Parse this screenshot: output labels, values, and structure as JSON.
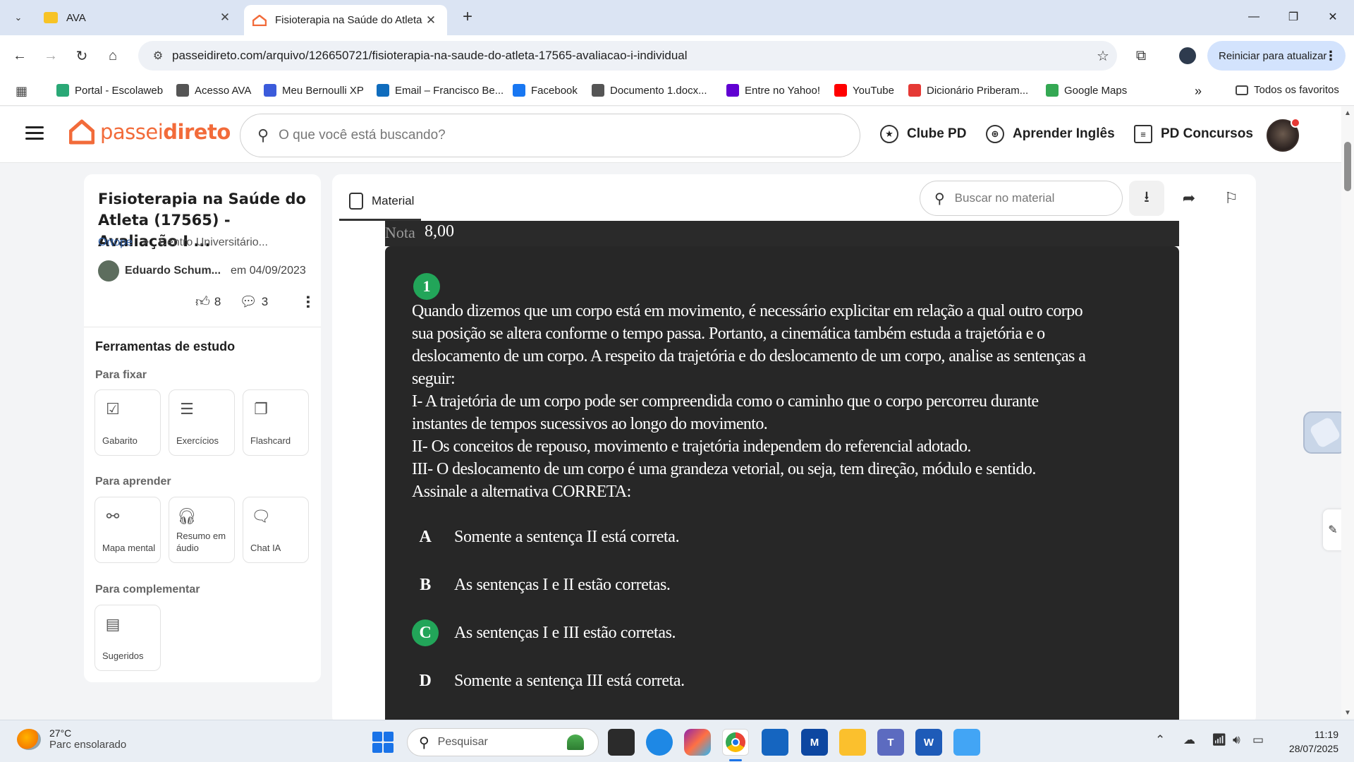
{
  "browser": {
    "tabs": [
      {
        "title": "AVA",
        "active": false
      },
      {
        "title": "Fisioterapia na Saúde do Atleta",
        "active": true
      }
    ],
    "url": "passeidireto.com/arquivo/126650721/fisioterapia-na-saude-do-atleta-17565-avaliacao-i-individual",
    "update_button": "Reiniciar para atualizar",
    "bookmarks": [
      {
        "label": "Portal - Escolaweb",
        "icon": "escolaweb-icon",
        "color": "#2aa876"
      },
      {
        "label": "Acesso AVA",
        "icon": "globe-icon",
        "color": "#555555"
      },
      {
        "label": "Meu Bernoulli XP",
        "icon": "bernoulli-icon",
        "color": "#3b5bdb"
      },
      {
        "label": "Email – Francisco Be...",
        "icon": "outlook-icon",
        "color": "#0f6cbd"
      },
      {
        "label": "Facebook",
        "icon": "facebook-icon",
        "color": "#1877f2"
      },
      {
        "label": "Documento 1.docx...",
        "icon": "globe-icon",
        "color": "#555555"
      },
      {
        "label": "Entre no Yahoo!",
        "icon": "yahoo-icon",
        "color": "#6001d2"
      },
      {
        "label": "YouTube",
        "icon": "youtube-icon",
        "color": "#ff0000"
      },
      {
        "label": "Dicionário Priberam...",
        "icon": "priberam-icon",
        "color": "#e53935"
      },
      {
        "label": "Google Maps",
        "icon": "maps-pin-icon",
        "color": "#34a853"
      }
    ],
    "all_bookmarks": "Todos os favoritos"
  },
  "site": {
    "logo_part1": "passei",
    "logo_part2": "direto",
    "brand_color": "#f26b3a",
    "search_placeholder": "O que você está buscando?",
    "nav": [
      "Clube PD",
      "Aprender Inglês",
      "PD Concursos"
    ]
  },
  "sidebar": {
    "title": "Fisioterapia na Saúde do Atleta (17565) - Avaliação I ...",
    "crumb1": "Ortope",
    "crumb_sep": ">",
    "crumb2": "Centro Universitário...",
    "author": "Eduardo Schum...",
    "date": "em 04/09/2023",
    "likes": "8",
    "comments": "3",
    "tools_title": "Ferramentas de estudo",
    "groups": {
      "fixar": "Para fixar",
      "aprender": "Para aprender",
      "complementar": "Para complementar"
    },
    "tiles": {
      "gabarito": "Gabarito",
      "exercicios": "Exercícios",
      "flashcard": "Flashcard",
      "mapa": "Mapa mental",
      "resumo": "Resumo em áudio",
      "chat": "Chat IA",
      "sugeridos": "Sugeridos"
    }
  },
  "viewer": {
    "tab": "Material",
    "search_placeholder": "Buscar no material",
    "nota_label": "Nota",
    "nota_value": "8,00",
    "question_number": "1",
    "question_lines": [
      "Quando dizemos que um corpo está em movimento, é necessário explicitar em relação a qual outro corpo",
      "sua posição se altera conforme o tempo passa. Portanto, a cinemática também estuda a trajetória e o",
      "deslocamento de um corpo. A respeito da trajetória e do deslocamento de um corpo, analise as sentenças a",
      "seguir:",
      "I- A trajetória de um corpo pode ser compreendida como o caminho que o corpo percorreu durante",
      "instantes de tempos sucessivos ao longo do movimento.",
      "II- Os conceitos de repouso, movimento e trajetória independem do referencial adotado.",
      "III- O deslocamento de um corpo é uma grandeza vetorial, ou seja, tem direção, módulo e sentido.",
      "Assinale a alternativa CORRETA:"
    ],
    "options": [
      {
        "letter": "A",
        "text": "Somente a sentença II está correta.",
        "correct": false
      },
      {
        "letter": "B",
        "text": "As sentenças I e II estão corretas.",
        "correct": false
      },
      {
        "letter": "C",
        "text": "As sentenças I e III estão corretas.",
        "correct": true
      },
      {
        "letter": "D",
        "text": "Somente a sentença III está correta.",
        "correct": false
      }
    ],
    "correct_color": "#22a559"
  },
  "taskbar": {
    "temperature": "27°C",
    "condition": "Parc ensolarado",
    "search": "Pesquisar",
    "time": "11:19",
    "date": "28/07/2025"
  }
}
